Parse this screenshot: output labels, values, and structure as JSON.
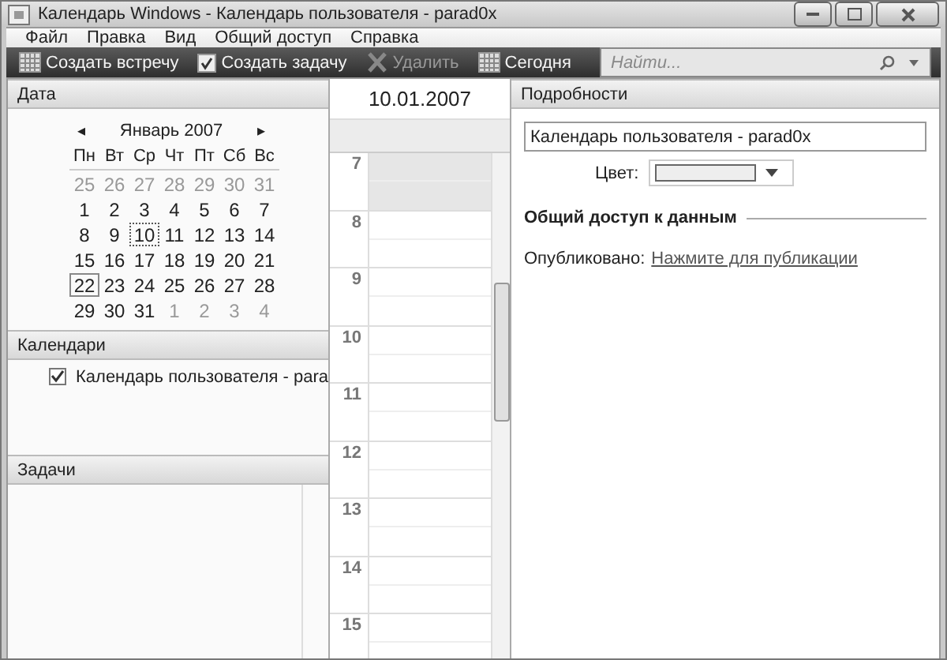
{
  "window": {
    "title": "Календарь Windows - Календарь пользователя - parad0x"
  },
  "menu": [
    "Файл",
    "Правка",
    "Вид",
    "Общий доступ",
    "Справка"
  ],
  "toolbar": [
    {
      "kind": "appointment",
      "label": "Создать встречу",
      "disabled": false
    },
    {
      "kind": "task",
      "label": "Создать задачу",
      "disabled": false
    },
    {
      "kind": "delete",
      "label": "Удалить",
      "disabled": true
    },
    {
      "kind": "today",
      "label": "Сегодня",
      "disabled": false
    }
  ],
  "search": {
    "placeholder": "Найти..."
  },
  "date_pane": {
    "title": "Дата",
    "month": "Январь 2007",
    "prev": "◂",
    "next": "▸",
    "weekdays": [
      "Пн",
      "Вт",
      "Ср",
      "Чт",
      "Пт",
      "Сб",
      "Вс"
    ],
    "weeks": [
      [
        {
          "d": "25",
          "other": true,
          "selected": false,
          "today": false
        },
        {
          "d": "26",
          "other": true,
          "selected": false,
          "today": false
        },
        {
          "d": "27",
          "other": true,
          "selected": false,
          "today": false
        },
        {
          "d": "28",
          "other": true,
          "selected": false,
          "today": false
        },
        {
          "d": "29",
          "other": true,
          "selected": false,
          "today": false
        },
        {
          "d": "30",
          "other": true,
          "selected": false,
          "today": false
        },
        {
          "d": "31",
          "other": true,
          "selected": false,
          "today": false
        }
      ],
      [
        {
          "d": "1",
          "other": false,
          "selected": false,
          "today": false
        },
        {
          "d": "2",
          "other": false,
          "selected": false,
          "today": false
        },
        {
          "d": "3",
          "other": false,
          "selected": false,
          "today": false
        },
        {
          "d": "4",
          "other": false,
          "selected": false,
          "today": false
        },
        {
          "d": "5",
          "other": false,
          "selected": false,
          "today": false
        },
        {
          "d": "6",
          "other": false,
          "selected": false,
          "today": false
        },
        {
          "d": "7",
          "other": false,
          "selected": false,
          "today": false
        }
      ],
      [
        {
          "d": "8",
          "other": false,
          "selected": false,
          "today": false
        },
        {
          "d": "9",
          "other": false,
          "selected": false,
          "today": false
        },
        {
          "d": "10",
          "other": false,
          "selected": true,
          "today": false
        },
        {
          "d": "11",
          "other": false,
          "selected": false,
          "today": false
        },
        {
          "d": "12",
          "other": false,
          "selected": false,
          "today": false
        },
        {
          "d": "13",
          "other": false,
          "selected": false,
          "today": false
        },
        {
          "d": "14",
          "other": false,
          "selected": false,
          "today": false
        }
      ],
      [
        {
          "d": "15",
          "other": false,
          "selected": false,
          "today": false
        },
        {
          "d": "16",
          "other": false,
          "selected": false,
          "today": false
        },
        {
          "d": "17",
          "other": false,
          "selected": false,
          "today": false
        },
        {
          "d": "18",
          "other": false,
          "selected": false,
          "today": false
        },
        {
          "d": "19",
          "other": false,
          "selected": false,
          "today": false
        },
        {
          "d": "20",
          "other": false,
          "selected": false,
          "today": false
        },
        {
          "d": "21",
          "other": false,
          "selected": false,
          "today": false
        }
      ],
      [
        {
          "d": "22",
          "other": false,
          "selected": false,
          "today": true
        },
        {
          "d": "23",
          "other": false,
          "selected": false,
          "today": false
        },
        {
          "d": "24",
          "other": false,
          "selected": false,
          "today": false
        },
        {
          "d": "25",
          "other": false,
          "selected": false,
          "today": false
        },
        {
          "d": "26",
          "other": false,
          "selected": false,
          "today": false
        },
        {
          "d": "27",
          "other": false,
          "selected": false,
          "today": false
        },
        {
          "d": "28",
          "other": false,
          "selected": false,
          "today": false
        }
      ],
      [
        {
          "d": "29",
          "other": false,
          "selected": false,
          "today": false
        },
        {
          "d": "30",
          "other": false,
          "selected": false,
          "today": false
        },
        {
          "d": "31",
          "other": false,
          "selected": false,
          "today": false
        },
        {
          "d": "1",
          "other": true,
          "selected": false,
          "today": false
        },
        {
          "d": "2",
          "other": true,
          "selected": false,
          "today": false
        },
        {
          "d": "3",
          "other": true,
          "selected": false,
          "today": false
        },
        {
          "d": "4",
          "other": true,
          "selected": false,
          "today": false
        }
      ]
    ]
  },
  "calendars_pane": {
    "title": "Календари",
    "items": [
      {
        "name": "Календарь пользователя - para",
        "checked": true
      }
    ]
  },
  "tasks_pane": {
    "title": "Задачи"
  },
  "day_view": {
    "date": "10.01.2007",
    "hours": [
      {
        "label": "7",
        "selected": true
      },
      {
        "label": "8",
        "selected": false
      },
      {
        "label": "9",
        "selected": false
      },
      {
        "label": "10",
        "selected": false
      },
      {
        "label": "11",
        "selected": false
      },
      {
        "label": "12",
        "selected": false
      },
      {
        "label": "13",
        "selected": false
      },
      {
        "label": "14",
        "selected": false
      },
      {
        "label": "15",
        "selected": false
      }
    ]
  },
  "details": {
    "title": "Подробности",
    "name_value": "Календарь пользователя - parad0x",
    "color_label": "Цвет:",
    "sharing_heading": "Общий доступ к данным",
    "published_label": "Опубликовано:",
    "publish_link": "Нажмите для публикации"
  }
}
